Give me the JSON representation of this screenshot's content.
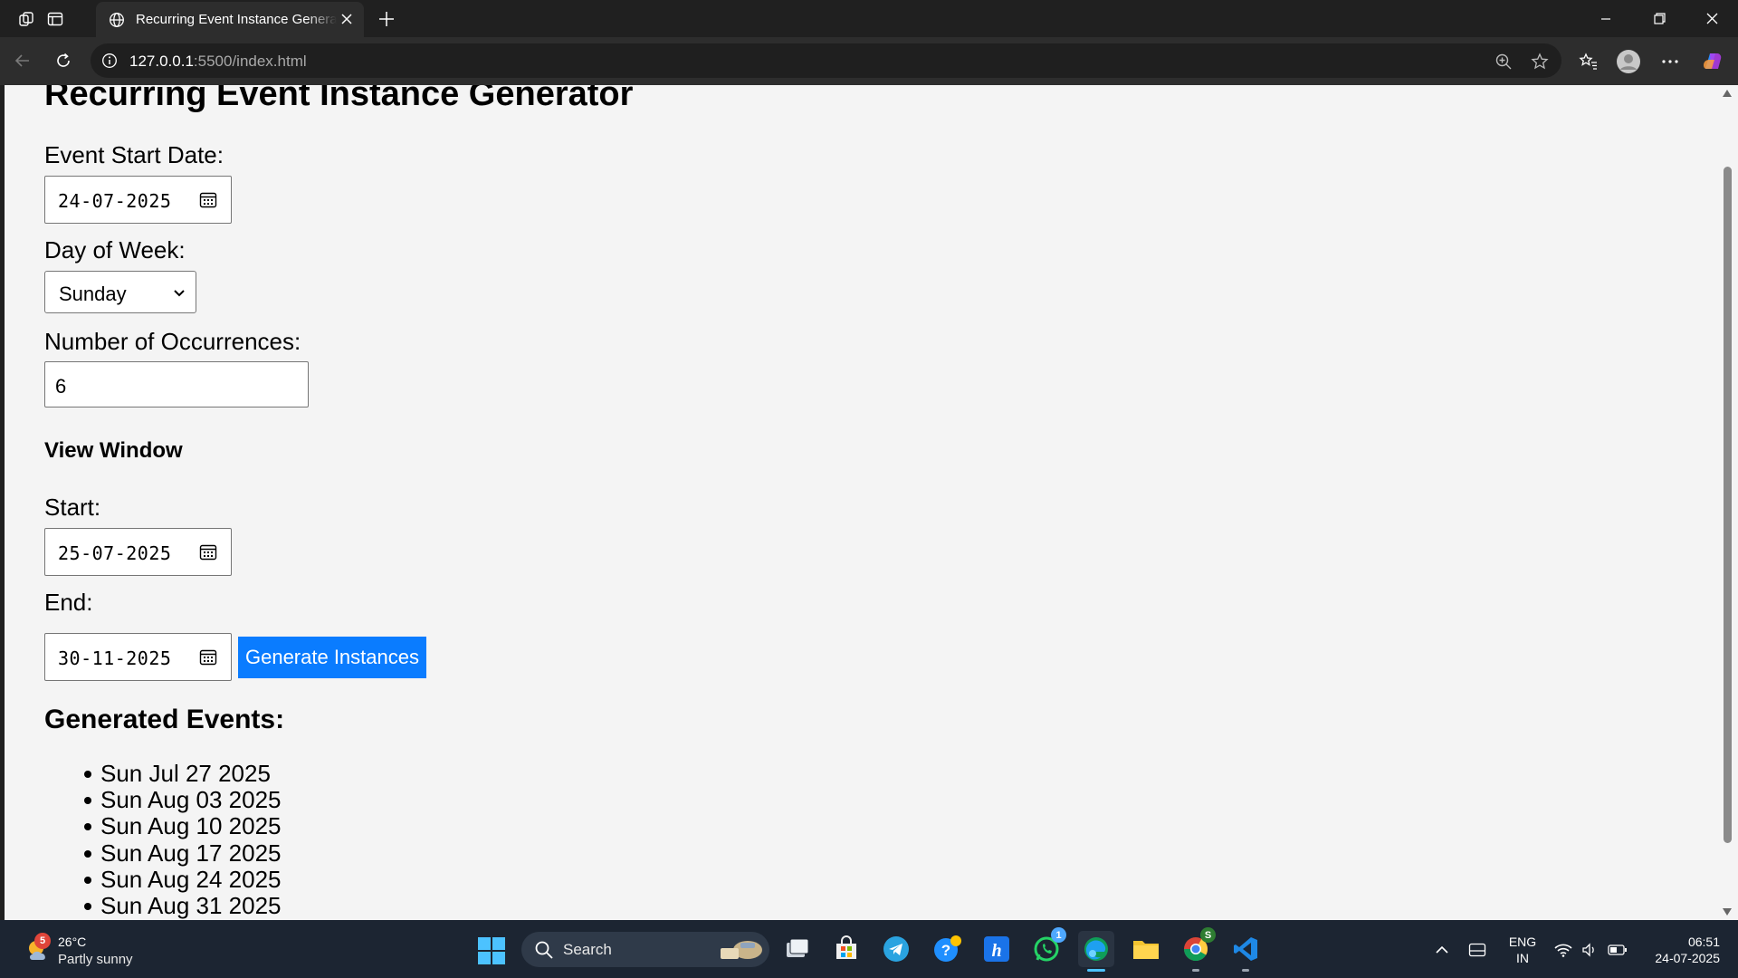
{
  "browser": {
    "tab_title": "Recurring Event Instance Generator",
    "url_host": "127.0.0.1",
    "url_rest": ":5500/index.html"
  },
  "page": {
    "title": "Recurring Event Instance Generator",
    "start_date_label": "Event Start Date:",
    "start_date_value": "24-07-2025",
    "day_label": "Day of Week:",
    "day_value": "Sunday",
    "occurrences_label": "Number of Occurrences:",
    "occurrences_value": "6",
    "view_window_heading": "View Window",
    "window_start_label": "Start:",
    "window_start_value": "25-07-2025",
    "window_end_label": "End:",
    "window_end_value": "30-11-2025",
    "generate_button": "Generate Instances",
    "results_heading": "Generated Events:",
    "events": [
      "Sun Jul 27 2025",
      "Sun Aug 03 2025",
      "Sun Aug 10 2025",
      "Sun Aug 17 2025",
      "Sun Aug 24 2025",
      "Sun Aug 31 2025"
    ]
  },
  "taskbar": {
    "weather_badge": "5",
    "weather_temp": "26°C",
    "weather_condition": "Partly sunny",
    "search_label": "Search",
    "whatsapp_badge": "1",
    "chrome_badge": "S",
    "lang_line1": "ENG",
    "lang_line2": "IN",
    "time": "06:51",
    "date": "24-07-2025"
  },
  "colors": {
    "button_blue": "#0a7cff",
    "page_background": "#f4f4f4",
    "taskbar_background": "#1c2532"
  }
}
